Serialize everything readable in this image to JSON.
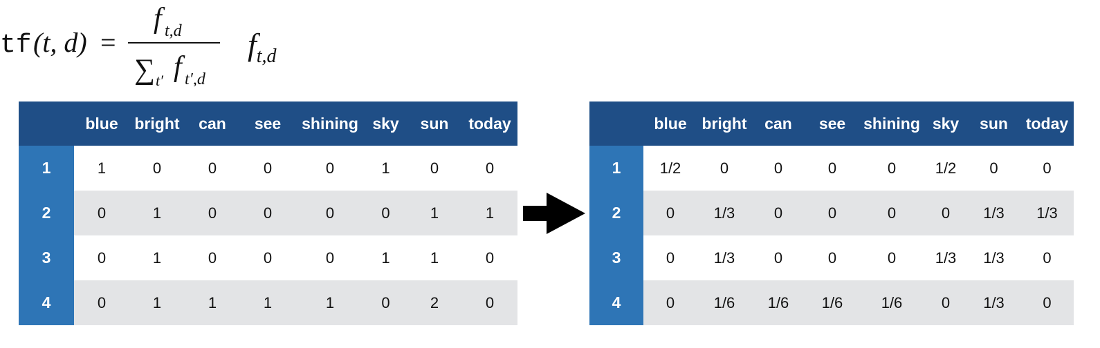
{
  "left_formula": {
    "base": "f",
    "subscript": "t,d"
  },
  "right_formula": {
    "lhs_func": "tf",
    "lhs_args": "(t, d)",
    "equals": "=",
    "numerator_base": "f",
    "numerator_sub": "t,d",
    "sum_symbol": "∑",
    "sum_sub": "t′",
    "denominator_base": "f",
    "denominator_sub": "t′,d"
  },
  "left_table": {
    "columns": [
      "blue",
      "bright",
      "can",
      "see",
      "shining",
      "sky",
      "sun",
      "today"
    ],
    "rows": [
      {
        "label": "1",
        "values": [
          "1",
          "0",
          "0",
          "0",
          "0",
          "1",
          "0",
          "0"
        ]
      },
      {
        "label": "2",
        "values": [
          "0",
          "1",
          "0",
          "0",
          "0",
          "0",
          "1",
          "1"
        ]
      },
      {
        "label": "3",
        "values": [
          "0",
          "1",
          "0",
          "0",
          "0",
          "1",
          "1",
          "0"
        ]
      },
      {
        "label": "4",
        "values": [
          "0",
          "1",
          "1",
          "1",
          "1",
          "0",
          "2",
          "0"
        ]
      }
    ]
  },
  "right_table": {
    "columns": [
      "blue",
      "bright",
      "can",
      "see",
      "shining",
      "sky",
      "sun",
      "today"
    ],
    "rows": [
      {
        "label": "1",
        "values": [
          "1/2",
          "0",
          "0",
          "0",
          "0",
          "1/2",
          "0",
          "0"
        ]
      },
      {
        "label": "2",
        "values": [
          "0",
          "1/3",
          "0",
          "0",
          "0",
          "0",
          "1/3",
          "1/3"
        ]
      },
      {
        "label": "3",
        "values": [
          "0",
          "1/3",
          "0",
          "0",
          "0",
          "1/3",
          "1/3",
          "0"
        ]
      },
      {
        "label": "4",
        "values": [
          "0",
          "1/6",
          "1/6",
          "1/6",
          "1/6",
          "0",
          "1/3",
          "0"
        ]
      }
    ]
  },
  "colors": {
    "header": "#1f4e86",
    "row_label": "#2e75b6",
    "stripe": "#e3e4e6",
    "arrow": "#000000"
  },
  "icons": {
    "arrow": "right-arrow-icon"
  }
}
